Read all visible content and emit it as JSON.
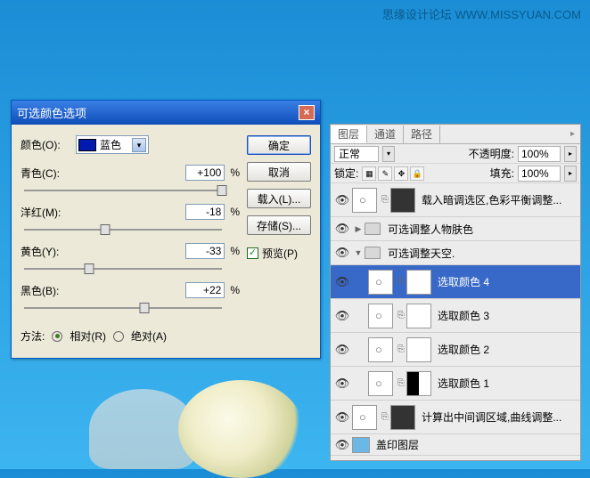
{
  "watermark": "思缘设计论坛  WWW.MISSYUAN.COM",
  "dialog": {
    "title": "可选颜色选项",
    "color_label": "颜色(O):",
    "color_value": "蓝色",
    "sliders": {
      "cyan": {
        "label": "青色(C):",
        "value": "+100",
        "pos": 100
      },
      "magenta": {
        "label": "洋红(M):",
        "value": "-18",
        "pos": 41
      },
      "yellow": {
        "label": "黄色(Y):",
        "value": "-33",
        "pos": 33
      },
      "black": {
        "label": "黑色(B):",
        "value": "+22",
        "pos": 61
      }
    },
    "method_label": "方法:",
    "method_relative": "相对(R)",
    "method_absolute": "绝对(A)",
    "ok": "确定",
    "cancel": "取消",
    "load": "载入(L)...",
    "save": "存储(S)...",
    "preview": "预览(P)"
  },
  "panel": {
    "tabs": {
      "layers": "图层",
      "channels": "通道",
      "paths": "路径"
    },
    "blend": "正常",
    "opacity_label": "不透明度:",
    "opacity": "100%",
    "lock_label": "锁定:",
    "fill_label": "填充:",
    "fill": "100%",
    "layers": {
      "l1": "载入暗调选区,色彩平衡调整...",
      "g1": "可选调整人物肤色",
      "g2": "可选调整天空.",
      "sc4": "选取颜色 4",
      "sc3": "选取颜色 3",
      "sc2": "选取颜色 2",
      "sc1": "选取颜色 1",
      "l6": "计算出中间调区域,曲线调整...",
      "l7": "盖印图层"
    }
  }
}
